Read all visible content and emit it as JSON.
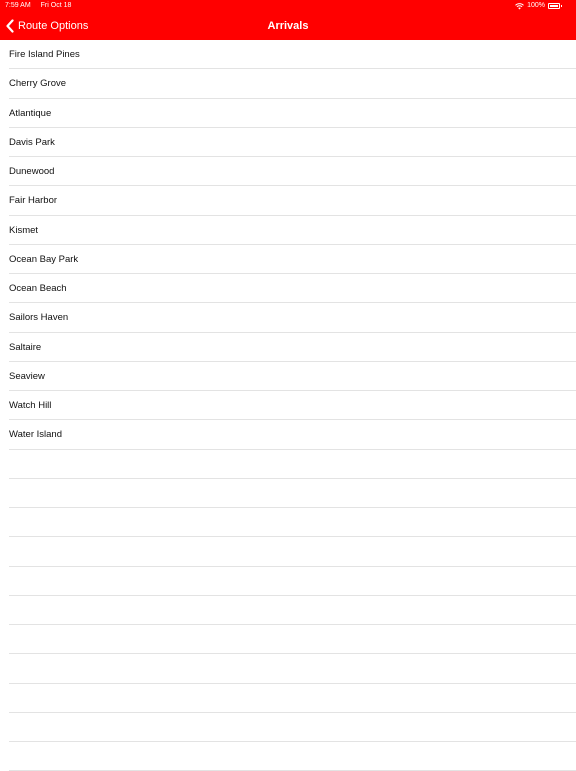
{
  "status_bar": {
    "time": "7:59 AM",
    "date": "Fri Oct 18",
    "battery_text": "100%",
    "battery_level": 1.0,
    "wifi_icon": "wifi-icon",
    "battery_icon": "battery-icon"
  },
  "nav": {
    "back_label": "Route Options",
    "back_icon": "chevron-left-icon",
    "title": "Arrivals",
    "bar_color": "#ff0000"
  },
  "arrivals": [
    "Fire Island Pines",
    "Cherry Grove",
    "Atlantique",
    "Davis Park",
    "Dunewood",
    "Fair Harbor",
    "Kismet",
    "Ocean Bay Park",
    "Ocean Beach",
    "Sailors Haven",
    "Saltaire",
    "Seaview",
    "Watch Hill",
    "Water Island"
  ]
}
